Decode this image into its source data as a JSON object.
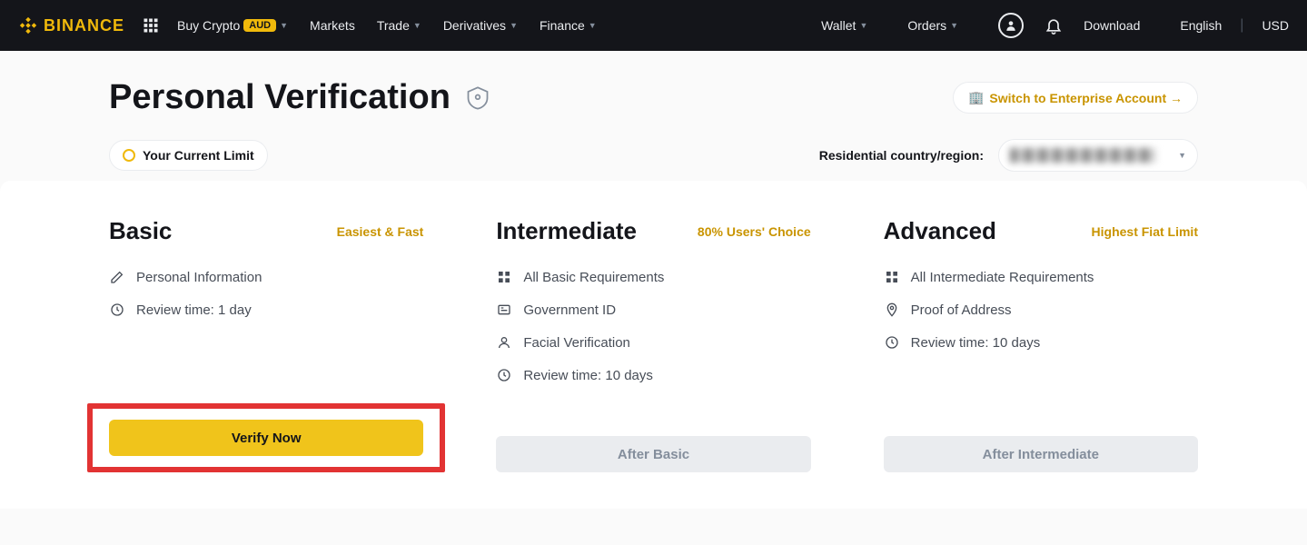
{
  "header": {
    "brand": "BINANCE",
    "nav": {
      "buy_crypto": "Buy Crypto",
      "aud_badge": "AUD",
      "markets": "Markets",
      "trade": "Trade",
      "derivatives": "Derivatives",
      "finance": "Finance"
    },
    "right": {
      "wallet": "Wallet",
      "orders": "Orders",
      "download": "Download",
      "language": "English",
      "currency": "USD"
    }
  },
  "page": {
    "title": "Personal Verification",
    "switch_label": "Switch to Enterprise Account →",
    "current_limit": "Your Current Limit",
    "country_label": "Residential country/region:"
  },
  "tiers": {
    "basic": {
      "title": "Basic",
      "tag": "Easiest & Fast",
      "req1": "Personal Information",
      "req2": "Review time: 1 day",
      "button": "Verify Now"
    },
    "intermediate": {
      "title": "Intermediate",
      "tag": "80% Users' Choice",
      "req1": "All Basic Requirements",
      "req2": "Government ID",
      "req3": "Facial Verification",
      "req4": "Review time: 10 days",
      "button": "After Basic"
    },
    "advanced": {
      "title": "Advanced",
      "tag": "Highest Fiat Limit",
      "req1": "All Intermediate Requirements",
      "req2": "Proof of Address",
      "req3": "Review time: 10 days",
      "button": "After Intermediate"
    }
  }
}
